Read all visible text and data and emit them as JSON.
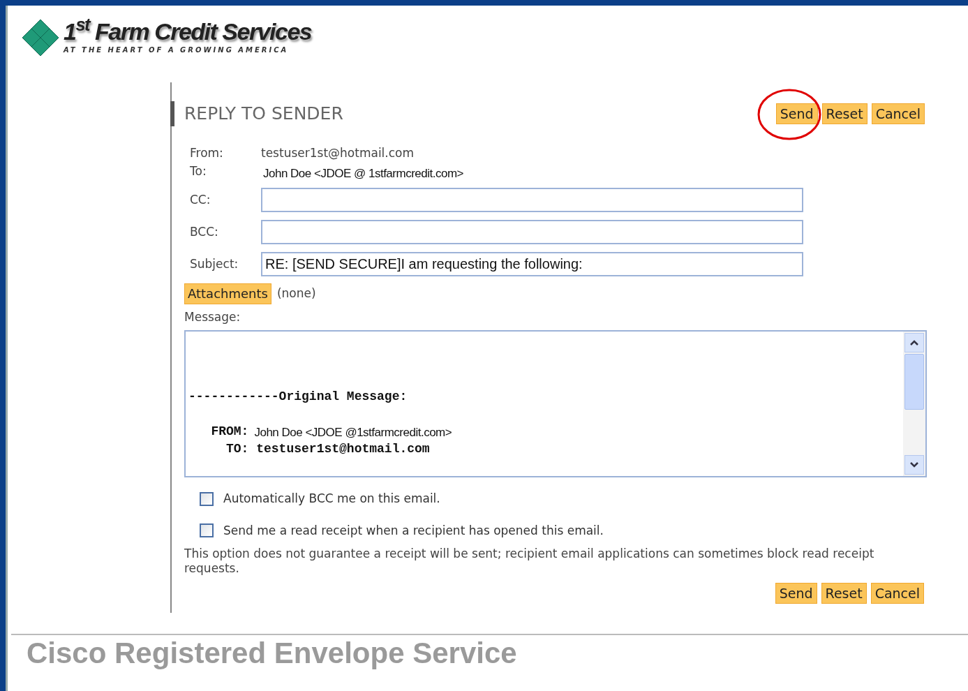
{
  "logo": {
    "name": "1$^{st}$ Farm Credit Services",
    "tagline": "AT THE HEART OF A GROWING AMERICA"
  },
  "heading": "REPLY TO SENDER",
  "top_buttons": [
    {
      "label": "Send",
      "highlighted": true
    },
    {
      "label": "Reset",
      "highlighted": false
    },
    {
      "label": "Cancel",
      "highlighted": false
    }
  ],
  "from": {
    "label": "From:",
    "value": "testuser1st@hotmail.com"
  },
  "to": {
    "label": "To:",
    "value": "John Doe <JDOE @ 1stfarmcredit.com>"
  },
  "fields": [
    {
      "label": "CC:"
    },
    {
      "label": "BCC:"
    },
    {
      "label": "Subject:",
      "value": "RE: [SEND SECURE]I am requesting the following:"
    }
  ],
  "attachments": {
    "button": "Attachments",
    "value": "(none)"
  },
  "message": {
    "label": "Message:",
    "lines": [
      {
        "kind": "separator",
        "label": "------------Original Message:"
      },
      {
        "kind": "header",
        "label": "   FROM:",
        "value": "John Doe <JDOE @1stfarmcredit.com>"
      },
      {
        "kind": "header",
        "label": "     TO: testuser1st@hotmail.com"
      }
    ]
  },
  "options": [
    {
      "label": "Automatically BCC me on this email.",
      "checked": false
    },
    {
      "label": "Send me a read receipt when a recipient has opened this email.",
      "checked": false
    }
  ],
  "note": "This option does not guarantee a receipt will be sent; recipient email applications can sometimes block read receipt requests.",
  "bottom_buttons": [
    {
      "label": "Send"
    },
    {
      "label": "Reset"
    },
    {
      "label": "Cancel"
    }
  ],
  "footer": "Cisco Registered Envelope Service"
}
